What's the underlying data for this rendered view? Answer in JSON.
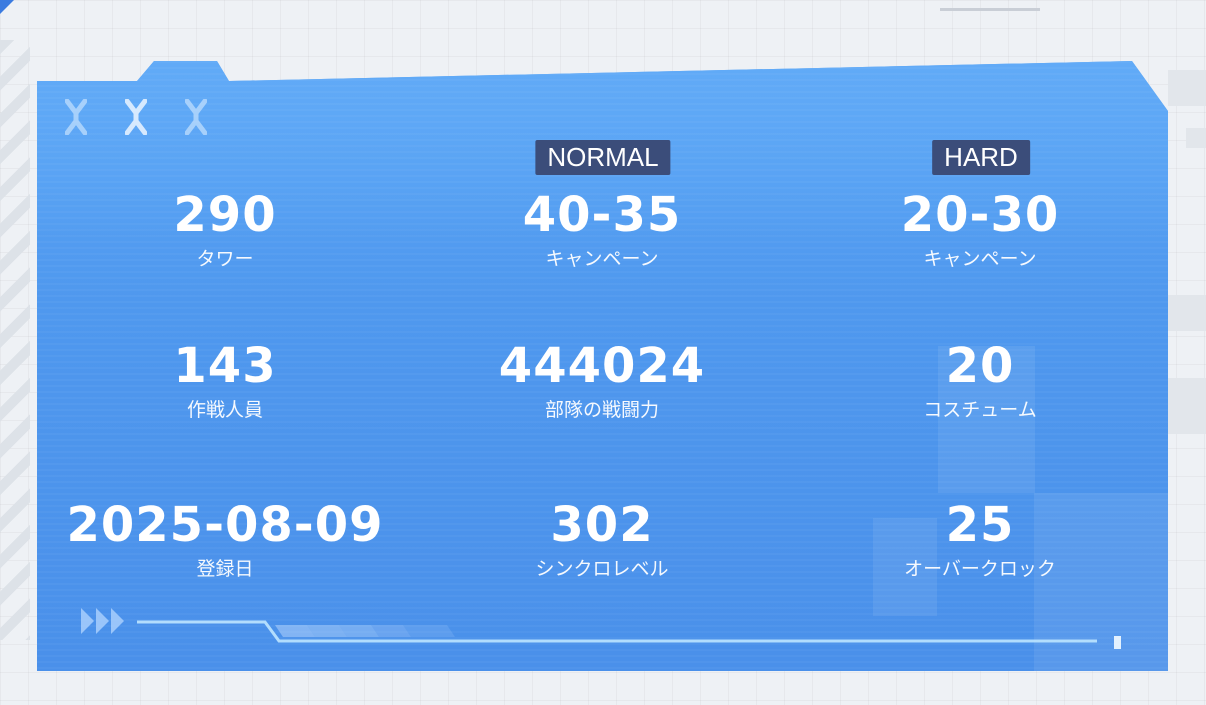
{
  "badges": {
    "normal": "NORMAL",
    "hard": "HARD"
  },
  "stats": [
    {
      "value": "290",
      "label": "タワー"
    },
    {
      "value": "40-35",
      "label": "キャンペーン"
    },
    {
      "value": "20-30",
      "label": "キャンペーン"
    },
    {
      "value": "143",
      "label": "作戦人員"
    },
    {
      "value": "444024",
      "label": "部隊の戦闘力"
    },
    {
      "value": "20",
      "label": "コスチューム"
    },
    {
      "value": "2025-08-09",
      "label": "登録日"
    },
    {
      "value": "302",
      "label": "シンクロレベル"
    },
    {
      "value": "25",
      "label": "オーバークロック"
    }
  ],
  "icons": {
    "header": [
      "x-mark-icon",
      "x-mark-icon",
      "x-mark-icon"
    ],
    "footer": "triple-arrow-icon"
  },
  "colors": {
    "panel": "#4f98ee",
    "badge": "#3b4d7a",
    "text": "#ffffff"
  }
}
